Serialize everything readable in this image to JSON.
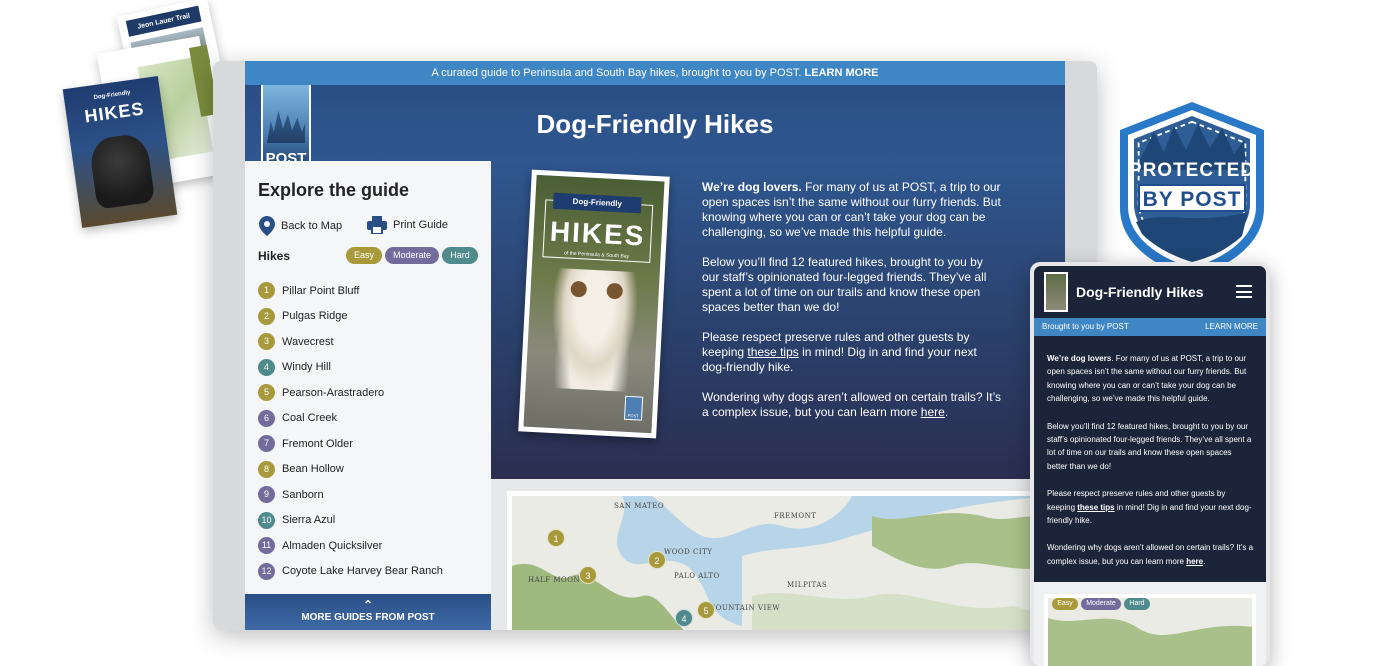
{
  "brochures": {
    "back_title": "Jeon Lauer Trail",
    "front_caption": "Dog-Friendly",
    "front_title": "HIKES"
  },
  "site": {
    "banner_text": "A curated guide to Peninsula and South Bay hikes, brought to you by POST.",
    "banner_link": "LEARN MORE",
    "logo_text": "POST",
    "title": "Dog-Friendly Hikes"
  },
  "sidebar": {
    "heading": "Explore the guide",
    "back_to_map": "Back to Map",
    "print_guide": "Print Guide",
    "hikes_label": "Hikes",
    "difficulty": [
      {
        "label": "Easy",
        "color": "#a89a3b"
      },
      {
        "label": "Moderate",
        "color": "#736b9c"
      },
      {
        "label": "Hard",
        "color": "#4f8a8d"
      }
    ],
    "hikes": [
      {
        "num": "1",
        "name": "Pillar Point Bluff",
        "level": "easy"
      },
      {
        "num": "2",
        "name": "Pulgas Ridge",
        "level": "easy"
      },
      {
        "num": "3",
        "name": "Wavecrest",
        "level": "easy"
      },
      {
        "num": "4",
        "name": "Windy Hill",
        "level": "hard"
      },
      {
        "num": "5",
        "name": "Pearson-Arastradero",
        "level": "easy"
      },
      {
        "num": "6",
        "name": "Coal Creek",
        "level": "moderate"
      },
      {
        "num": "7",
        "name": "Fremont Older",
        "level": "moderate"
      },
      {
        "num": "8",
        "name": "Bean Hollow",
        "level": "easy"
      },
      {
        "num": "9",
        "name": "Sanborn",
        "level": "moderate"
      },
      {
        "num": "10",
        "name": "Sierra Azul",
        "level": "hard"
      },
      {
        "num": "11",
        "name": "Almaden Quicksilver",
        "level": "moderate"
      },
      {
        "num": "12",
        "name": "Coyote Lake Harvey Bear Ranch",
        "level": "moderate"
      }
    ],
    "more_guides": "MORE GUIDES FROM POST"
  },
  "cover": {
    "band": "Dog-Friendly",
    "title": "HIKES",
    "subtitle": "of the Peninsula & South Bay",
    "badge": "POST"
  },
  "intro": {
    "p1_lead": "We’re dog lovers.",
    "p1_rest": " For many of us at POST, a trip to our open spaces isn’t the same without our furry friends. But knowing where you can or can’t take your dog can be challenging, so we’ve made this helpful guide.",
    "p2": "Below you’ll find 12 featured hikes, brought to you by our staff’s opinionated four-legged friends. They’ve all spent a lot of time on our trails and know these open spaces better than we do!",
    "p3_a": "Please respect preserve rules and other guests by keeping ",
    "p3_link": "these tips",
    "p3_b": " in mind! Dig in and find your next dog-friendly hike.",
    "p4_a": "Wondering why dogs aren’t allowed on certain trails? It’s a complex issue, but you can learn more ",
    "p4_link": "here",
    "p4_b": "."
  },
  "map": {
    "labels": [
      "SAN MATEO",
      "FREMONT",
      "WOOD CITY",
      "HALF MOON",
      "PALO ALTO",
      "MILPITAS",
      "MOUNTAIN VIEW"
    ],
    "markers": [
      "1",
      "2",
      "3",
      "5",
      "4"
    ]
  },
  "badge": {
    "line1": "PROTECTED",
    "line2": "BY POST"
  },
  "mobile": {
    "title": "Dog-Friendly Hikes",
    "bar_left": "Brought to you by POST",
    "bar_right": "LEARN MORE",
    "p1_lead": "We’re dog lovers",
    "p1_rest": ". For many of us at POST, a trip to our open spaces isn’t the same without our furry friends. But knowing where you can or can’t take your dog can be challenging, so we’ve made this helpful guide.",
    "p2": "Below you’ll find 12 featured hikes, brought to you by our staff’s opinionated four-legged friends. They’ve all spent a lot of time on our trails and know these open spaces better than we do!",
    "p3_a": "Please respect preserve rules and other guests by keeping ",
    "p3_link": "these tips",
    "p3_b": " in mind! Dig in and find your next dog-friendly hike.",
    "p4_a": "Wondering why dogs aren’t allowed on certain trails? It’s a complex issue, but you can learn more ",
    "p4_link": "here",
    "p4_b": ".",
    "pills": [
      "Easy",
      "Moderate",
      "Hard"
    ]
  }
}
